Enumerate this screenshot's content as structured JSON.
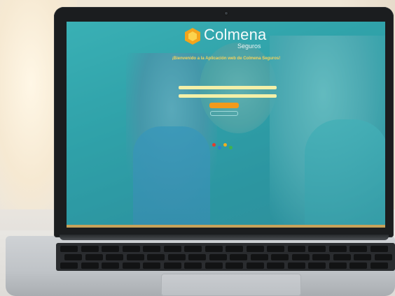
{
  "colors": {
    "accent": "#f6d35a",
    "button": "#f29a1c",
    "screen_tint": "#3fb4b8"
  },
  "brand": {
    "name": "Colmena",
    "sub": "Seguros",
    "icon": "hexagon-logo-icon"
  },
  "login": {
    "welcome": "¡Bienvenido a la Aplicación web de Colmena Seguros!",
    "intro": "",
    "links": [
      "",
      "",
      ""
    ],
    "user_label": "",
    "password_label": "",
    "user_placeholder": "",
    "password_placeholder": "",
    "submit_label": "",
    "register_label": "",
    "notice": "",
    "copyright": ""
  }
}
